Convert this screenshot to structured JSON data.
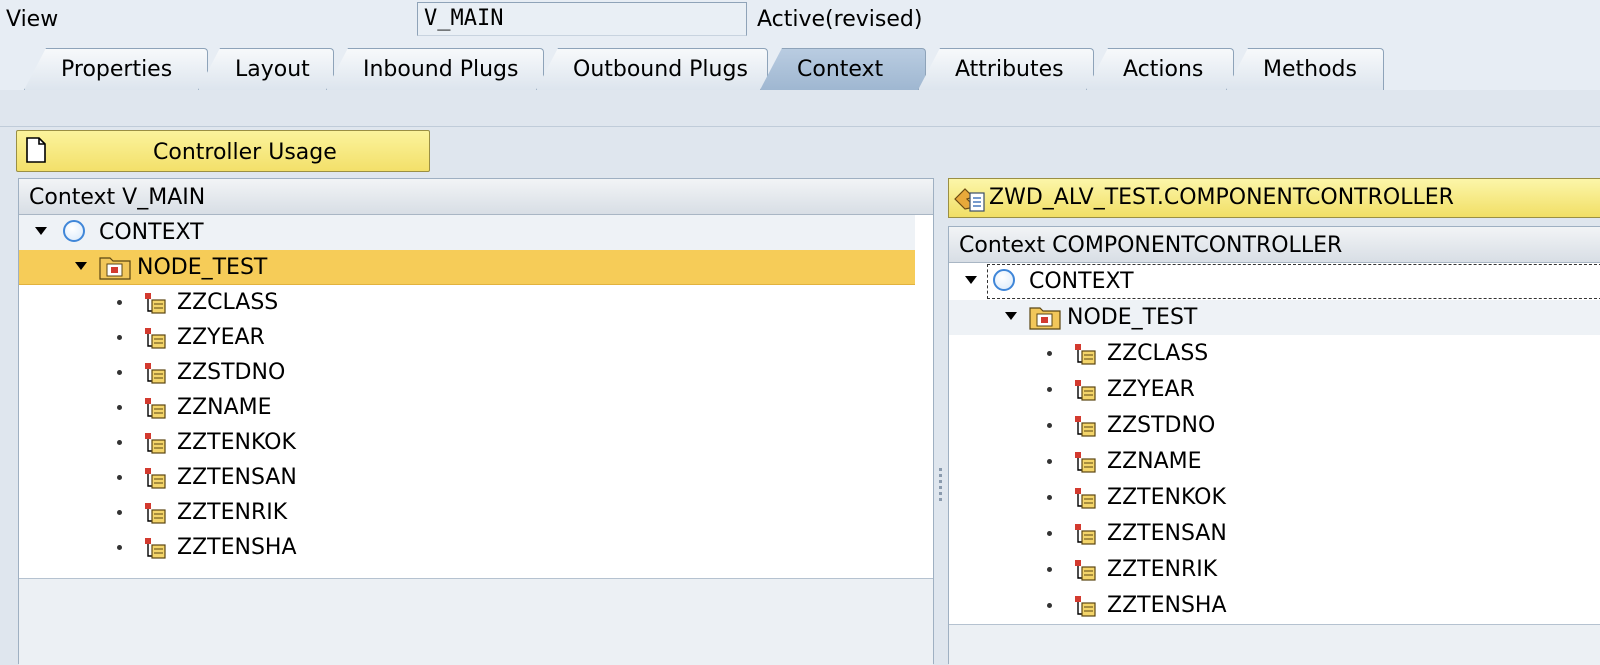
{
  "header": {
    "view_label": "View",
    "view_value": "V_MAIN",
    "status": "Active(revised)"
  },
  "tabs": [
    {
      "label": "Properties",
      "active": false
    },
    {
      "label": "Layout",
      "active": false
    },
    {
      "label": "Inbound Plugs",
      "active": false
    },
    {
      "label": "Outbound Plugs",
      "active": false
    },
    {
      "label": "Context",
      "active": true
    },
    {
      "label": "Attributes",
      "active": false
    },
    {
      "label": "Actions",
      "active": false
    },
    {
      "label": "Methods",
      "active": false
    }
  ],
  "toolbar": {
    "controller_usage_label": "Controller Usage"
  },
  "left_context": {
    "title": "Context V_MAIN",
    "root": "CONTEXT",
    "node": "NODE_TEST",
    "attributes": [
      "ZZCLASS",
      "ZZYEAR",
      "ZZSTDNO",
      "ZZNAME",
      "ZZTENKOK",
      "ZZTENSAN",
      "ZZTENRIK",
      "ZZTENSHA"
    ]
  },
  "right_context": {
    "controller": "ZWD_ALV_TEST.COMPONENTCONTROLLER",
    "title": "Context COMPONENTCONTROLLER",
    "root": "CONTEXT",
    "node": "NODE_TEST",
    "attributes": [
      "ZZCLASS",
      "ZZYEAR",
      "ZZSTDNO",
      "ZZNAME",
      "ZZTENKOK",
      "ZZTENSAN",
      "ZZTENRIK",
      "ZZTENSHA"
    ]
  },
  "colors": {
    "active_tab": "#a9c0d9",
    "selected_node": "#f6cc58",
    "button_yellow": "#f3e06a"
  }
}
